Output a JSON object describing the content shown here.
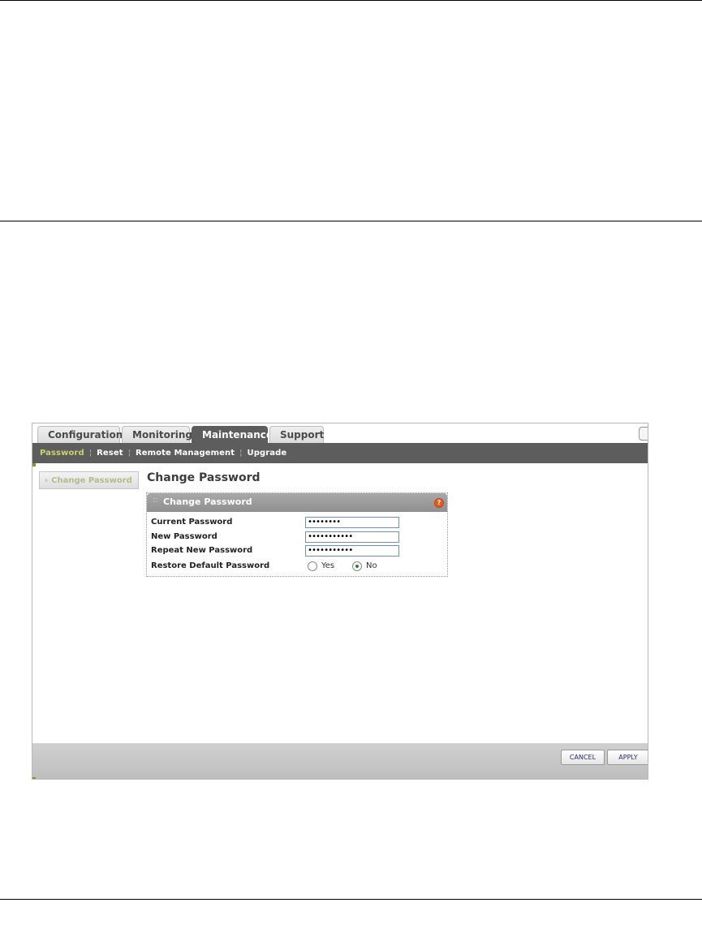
{
  "tabs": [
    "Configuration",
    "Monitoring",
    "Maintenance",
    "Support"
  ],
  "active_tab": "Maintenance",
  "subnav": [
    "Password",
    "Reset",
    "Remote Management",
    "Upgrade"
  ],
  "active_subnav": "Password",
  "sidebar": {
    "change_password": "Change Password"
  },
  "page_title": "Change Password",
  "panel": {
    "title": "Change Password",
    "fields": {
      "current_label": "Current Password",
      "current_value": "••••••••",
      "new_label": "New Password",
      "new_value": "•••••••••••",
      "repeat_label": "Repeat New Password",
      "repeat_value": "•••••••••••",
      "restore_label": "Restore Default Password",
      "yes_label": "Yes",
      "no_label": "No",
      "restore_selected": "No"
    }
  },
  "buttons": {
    "cancel": "CANCEL",
    "apply": "APPLY"
  },
  "icons": {
    "help": "help-icon",
    "sidebar_chevron": "chevron-right-icon"
  },
  "colors": {
    "nav_bg": "#5d5d5d",
    "active_subnav": "#c9d36d"
  }
}
